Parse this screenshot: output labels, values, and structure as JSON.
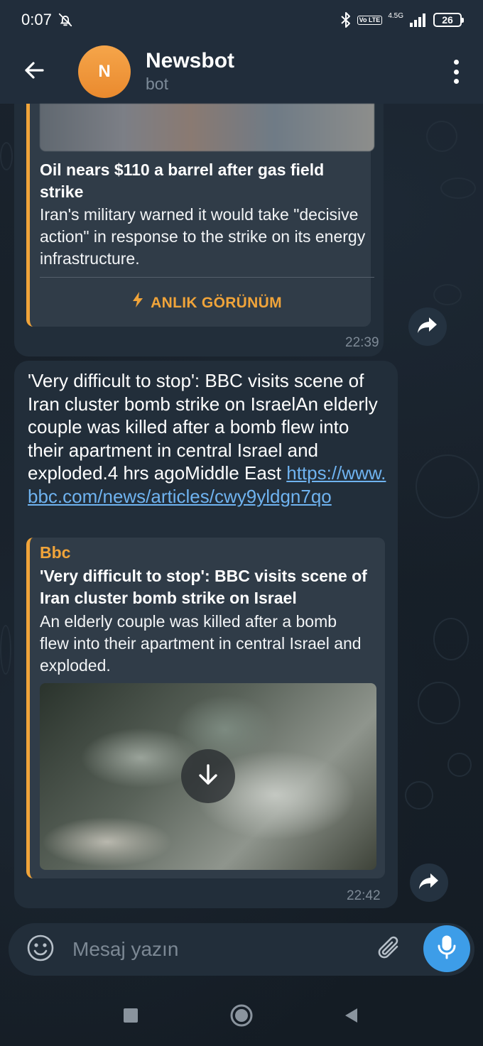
{
  "status_bar": {
    "time": "0:07",
    "volte": "Vo LTE",
    "network": "4.5G",
    "battery": "26"
  },
  "header": {
    "avatar_letter": "N",
    "title": "Newsbot",
    "subtitle": "bot"
  },
  "messages": [
    {
      "preview": {
        "title": "Oil nears $110 a barrel after gas field strike",
        "description": "Iran's military warned it would take \"decisive action\" in response to the strike on its energy infrastructure.",
        "instant_view_label": "ANLIK GÖRÜNÜM"
      },
      "time": "22:39"
    },
    {
      "text": "'Very difficult to stop': BBC visits scene of Iran cluster bomb strike on IsraelAn elderly couple was killed after a bomb flew into their apartment in central Israel and exploded.4 hrs agoMiddle East",
      "link": "https://www.bbc.com/news/articles/cwy9yldgn7qo",
      "preview": {
        "site_name": "Bbc",
        "title": "'Very difficult to stop': BBC visits scene of Iran cluster bomb strike on Israel",
        "description": "An elderly couple was killed after a bomb flew into their apartment in central Israel and exploded."
      },
      "time": "22:42"
    }
  ],
  "composer": {
    "placeholder": "Mesaj yazın"
  },
  "icons": {
    "back": "arrow-left-icon",
    "menu": "more-vertical-icon",
    "share": "share-arrow-icon",
    "emoji": "emoji-icon",
    "attach": "paperclip-icon",
    "mic": "microphone-icon",
    "download": "download-arrow-icon"
  },
  "colors": {
    "accent_orange": "#f0a43a",
    "link_blue": "#6fb3f0",
    "mic_blue": "#3d9de8",
    "bubble": "#222e3a",
    "header": "#212d3b"
  }
}
